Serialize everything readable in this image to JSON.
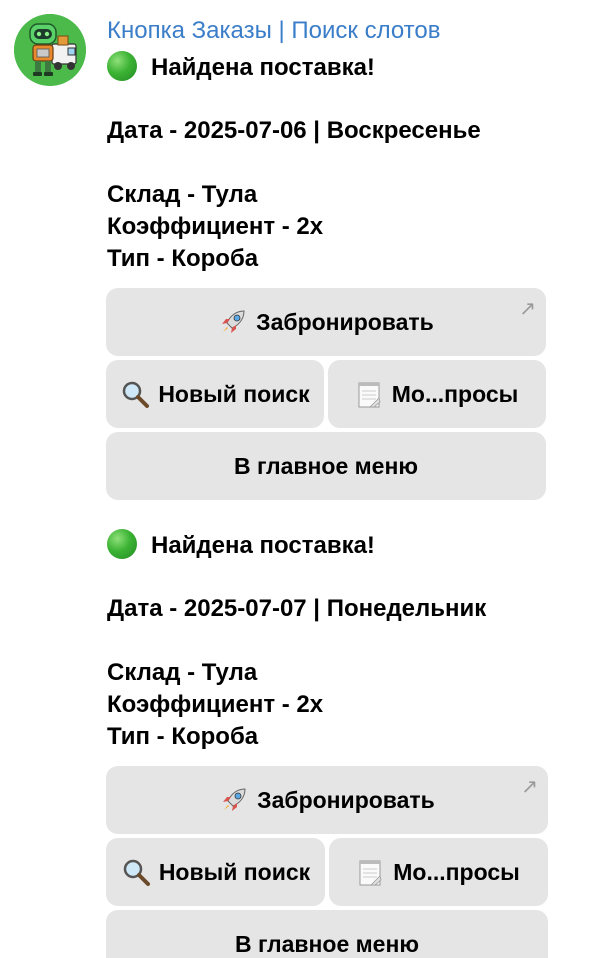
{
  "chat": {
    "sender": "Кнопка Заказы | Поиск слотов",
    "avatar_icon": "robot-delivery-avatar-icon",
    "accent_color": "#3a7dc9"
  },
  "messages": [
    {
      "status_icon": "green-circle-icon",
      "headline": "Найдена поставка!",
      "date_line": "Дата - 2025-07-06 | Воскресенье",
      "warehouse_line": "Склад - Тула",
      "coefficient_line": "Коэффициент - 2x",
      "type_line": "Тип - Короба",
      "buttons": {
        "book_label": "Забронировать",
        "book_icon": "rocket-icon",
        "new_search_label": "Новый поиск",
        "new_search_icon": "magnifier-icon",
        "my_requests_label": "Мо...просы",
        "my_requests_icon": "memo-icon",
        "main_menu_label": "В главное меню"
      }
    },
    {
      "status_icon": "green-circle-icon",
      "headline": "Найдена поставка!",
      "date_line": "Дата - 2025-07-07 | Понедельник",
      "warehouse_line": "Склад - Тула",
      "coefficient_line": "Коэффициент - 2x",
      "type_line": "Тип - Короба",
      "buttons": {
        "book_label": "Забронировать",
        "book_icon": "rocket-icon",
        "new_search_label": "Новый поиск",
        "new_search_icon": "magnifier-icon",
        "my_requests_label": "Мо...просы",
        "my_requests_icon": "memo-icon",
        "main_menu_label": "В главное меню"
      }
    }
  ]
}
